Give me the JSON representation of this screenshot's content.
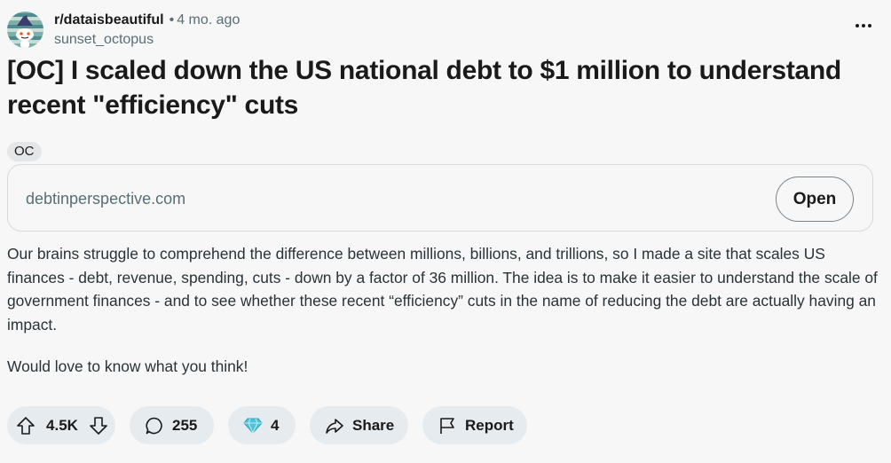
{
  "header": {
    "subreddit": "r/dataisbeautiful",
    "separator": "•",
    "age": "4 mo. ago",
    "username": "sunset_octopus",
    "avatar_icon": "snoo-avatar-icon",
    "menu_icon": "more-options-icon"
  },
  "post": {
    "title": "[OC] I scaled down the US national debt to $1 million to understand recent \"efficiency\" cuts",
    "flair": "OC",
    "link": {
      "domain": "debtinperspective.com",
      "open_label": "Open"
    },
    "body": [
      "Our brains struggle to comprehend the difference between millions, billions, and trillions, so I made a site that scales US finances - debt, revenue, spending, cuts - down by a factor of 36 million. The idea is to make it easier to understand the scale of government finances - and to see whether these recent “efficiency” cuts in the name of reducing the debt are actually having an impact.",
      "Would love to know what you think!"
    ]
  },
  "actions": {
    "votes": "4.5K",
    "comments": "255",
    "awards": "4",
    "share_label": "Share",
    "report_label": "Report"
  },
  "colors": {
    "background": "#f7f7f7",
    "pill": "#e5ebee",
    "meta_text": "#576f76",
    "award_gem": "#4fc3d9"
  }
}
